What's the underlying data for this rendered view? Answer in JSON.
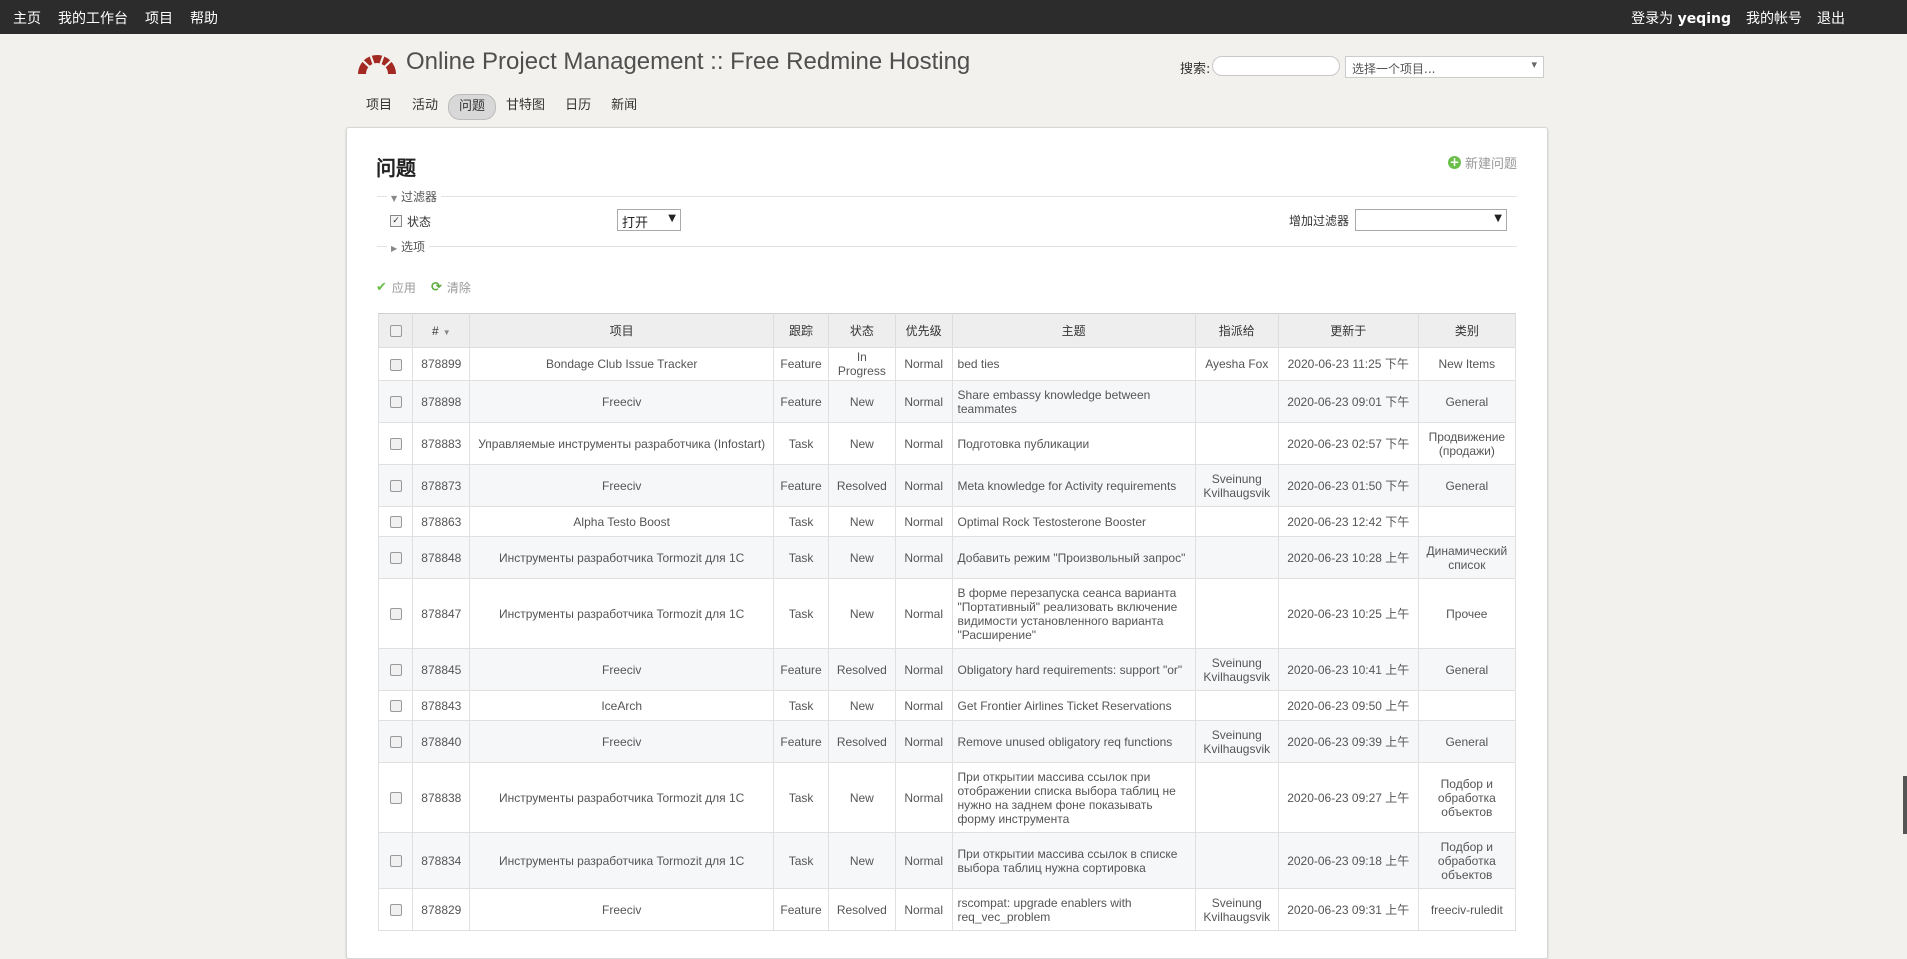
{
  "topbar": {
    "left": [
      "主页",
      "我的工作台",
      "项目",
      "帮助"
    ],
    "login_prefix": "登录为",
    "user": "yeqing",
    "my_account": "我的帐号",
    "logout": "退出"
  },
  "header": {
    "title": "Online Project Management :: Free Redmine Hosting",
    "search_label": "搜索:",
    "search_value": "",
    "project_select": "选择一个项目..."
  },
  "main_menu": {
    "tabs": [
      "项目",
      "活动",
      "问题",
      "甘特图",
      "日历",
      "新闻"
    ],
    "selected": "问题"
  },
  "page": {
    "title": "问题",
    "new_issue": "新建问题"
  },
  "filters": {
    "legend": "过滤器",
    "status_label": "状态",
    "status_value": "打开",
    "add_filter_label": "增加过滤器",
    "options_legend": "选项",
    "apply": "应用",
    "clear": "清除"
  },
  "table": {
    "headers": [
      "#",
      "项目",
      "跟踪",
      "状态",
      "优先级",
      "主题",
      "指派给",
      "更新于",
      "类别"
    ],
    "rows": [
      {
        "id": "878899",
        "project": "Bondage Club Issue Tracker",
        "tracker": "Feature",
        "status": "In Progress",
        "priority": "Normal",
        "subject": "bed ties",
        "assignee": "Ayesha Fox",
        "updated": "2020-06-23 11:25 下午",
        "category": "New Items"
      },
      {
        "id": "878898",
        "project": "Freeciv",
        "tracker": "Feature",
        "status": "New",
        "priority": "Normal",
        "subject": "Share embassy knowledge between teammates",
        "assignee": "",
        "updated": "2020-06-23 09:01 下午",
        "category": "General"
      },
      {
        "id": "878883",
        "project": "Управляемые инструменты разработчика (Infostart)",
        "tracker": "Task",
        "status": "New",
        "priority": "Normal",
        "subject": "Подготовка публикации",
        "assignee": "",
        "updated": "2020-06-23 02:57 下午",
        "category": "Продвижение (продажи)"
      },
      {
        "id": "878873",
        "project": "Freeciv",
        "tracker": "Feature",
        "status": "Resolved",
        "priority": "Normal",
        "subject": "Meta knowledge for Activity requirements",
        "assignee": "Sveinung Kvilhaugsvik",
        "updated": "2020-06-23 01:50 下午",
        "category": "General"
      },
      {
        "id": "878863",
        "project": "Alpha Testo Boost",
        "tracker": "Task",
        "status": "New",
        "priority": "Normal",
        "subject": "Optimal Rock Testosterone Booster",
        "assignee": "",
        "updated": "2020-06-23 12:42 下午",
        "category": ""
      },
      {
        "id": "878848",
        "project": "Инструменты разработчика Tormozit для 1С",
        "tracker": "Task",
        "status": "New",
        "priority": "Normal",
        "subject": "Добавить режим \"Произвольный запрос\"",
        "assignee": "",
        "updated": "2020-06-23 10:28 上午",
        "category": "Динамический список"
      },
      {
        "id": "878847",
        "project": "Инструменты разработчика Tormozit для 1С",
        "tracker": "Task",
        "status": "New",
        "priority": "Normal",
        "subject": "В форме перезапуска сеанса варианта \"Портативный\" реализовать включение видимости установленного варианта \"Расширение\"",
        "assignee": "",
        "updated": "2020-06-23 10:25 上午",
        "category": "Прочее"
      },
      {
        "id": "878845",
        "project": "Freeciv",
        "tracker": "Feature",
        "status": "Resolved",
        "priority": "Normal",
        "subject": "Obligatory hard requirements: support \"or\"",
        "assignee": "Sveinung Kvilhaugsvik",
        "updated": "2020-06-23 10:41 上午",
        "category": "General"
      },
      {
        "id": "878843",
        "project": "IceArch",
        "tracker": "Task",
        "status": "New",
        "priority": "Normal",
        "subject": "Get Frontier Airlines Ticket Reservations",
        "assignee": "",
        "updated": "2020-06-23 09:50 上午",
        "category": ""
      },
      {
        "id": "878840",
        "project": "Freeciv",
        "tracker": "Feature",
        "status": "Resolved",
        "priority": "Normal",
        "subject": "Remove unused obligatory req functions",
        "assignee": "Sveinung Kvilhaugsvik",
        "updated": "2020-06-23 09:39 上午",
        "category": "General"
      },
      {
        "id": "878838",
        "project": "Инструменты разработчика Tormozit для 1С",
        "tracker": "Task",
        "status": "New",
        "priority": "Normal",
        "subject": "При открытии массива ссылок при отображении списка выбора таблиц не нужно на заднем фоне показывать форму инструмента",
        "assignee": "",
        "updated": "2020-06-23 09:27 上午",
        "category": "Подбор и обработка объектов"
      },
      {
        "id": "878834",
        "project": "Инструменты разработчика Tormozit для 1С",
        "tracker": "Task",
        "status": "New",
        "priority": "Normal",
        "subject": "При открытии массива ссылок в списке выбора таблиц нужна сортировка",
        "assignee": "",
        "updated": "2020-06-23 09:18 上午",
        "category": "Подбор и обработка объектов"
      },
      {
        "id": "878829",
        "project": "Freeciv",
        "tracker": "Feature",
        "status": "Resolved",
        "priority": "Normal",
        "subject": "rscompat: upgrade enablers with req_vec_problem",
        "assignee": "Sveinung Kvilhaugsvik",
        "updated": "2020-06-23 09:31 上午",
        "category": "freeciv-ruledit"
      }
    ]
  },
  "colors": {
    "topbar": "#2c2c2c",
    "background": "#f2f1ed",
    "logo": "#a32a22",
    "accent_green": "#6abf4b"
  }
}
